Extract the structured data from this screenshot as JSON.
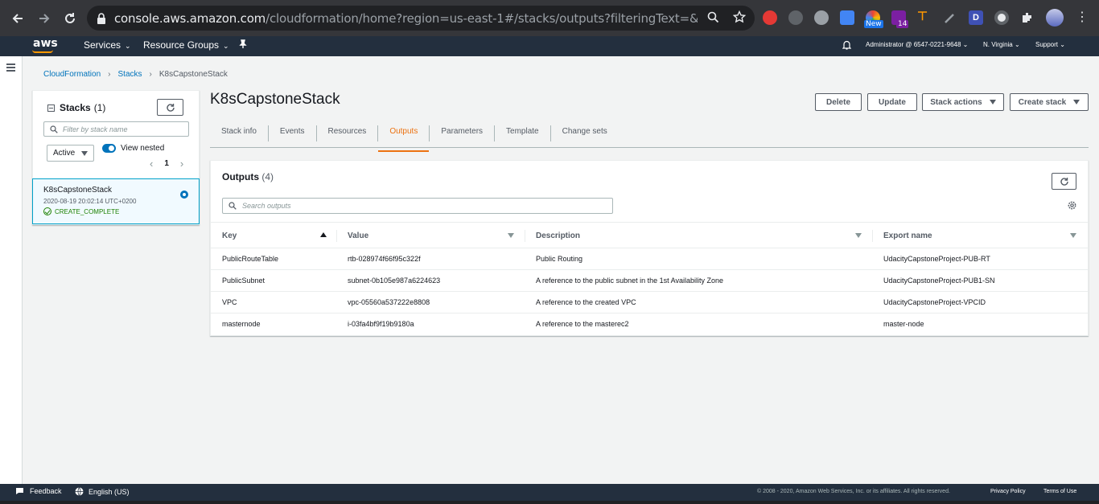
{
  "browser": {
    "url_host": "console.aws.amazon.com",
    "url_rest": "/cloudformation/home?region=us-east-1#/stacks/outputs?filteringText=&filteringStatus=...",
    "ext_badge_new": "New",
    "ext_badge_count": "14",
    "ext_letter": "D"
  },
  "awsnav": {
    "logo": "aws",
    "services": "Services",
    "resource_groups": "Resource Groups",
    "account": "Administrator @ 6547-0221-9648",
    "region": "N. Virginia",
    "support": "Support"
  },
  "breadcrumb": {
    "items": [
      "CloudFormation",
      "Stacks",
      "K8sCapstoneStack"
    ]
  },
  "stacks_panel": {
    "title": "Stacks",
    "count": "(1)",
    "filter_placeholder": "Filter by stack name",
    "status_filter": "Active",
    "view_nested": "View nested",
    "page": "1",
    "stack": {
      "name": "K8sCapstoneStack",
      "date": "2020-08-19 20:02:14 UTC+0200",
      "status": "CREATE_COMPLETE"
    }
  },
  "main": {
    "title": "K8sCapstoneStack",
    "buttons": {
      "delete": "Delete",
      "update": "Update",
      "stack_actions": "Stack actions",
      "create_stack": "Create stack"
    },
    "tabs": [
      "Stack info",
      "Events",
      "Resources",
      "Outputs",
      "Parameters",
      "Template",
      "Change sets"
    ],
    "active_tab": "Outputs"
  },
  "outputs": {
    "title": "Outputs",
    "count": "(4)",
    "search_placeholder": "Search outputs",
    "columns": [
      "Key",
      "Value",
      "Description",
      "Export name"
    ],
    "rows": [
      [
        "PublicRouteTable",
        "rtb-028974f66f95c322f",
        "Public Routing",
        "UdacityCapstoneProject-PUB-RT"
      ],
      [
        "PublicSubnet",
        "subnet-0b105e987a6224623",
        "A reference to the public subnet in the 1st Availability Zone",
        "UdacityCapstoneProject-PUB1-SN"
      ],
      [
        "VPC",
        "vpc-05560a537222e8808",
        "A reference to the created VPC",
        "UdacityCapstoneProject-VPCID"
      ],
      [
        "masternode",
        "i-03fa4bf9f19b9180a",
        "A reference to the masterec2",
        "master-node"
      ]
    ]
  },
  "footer": {
    "feedback": "Feedback",
    "language": "English (US)",
    "copyright": "© 2008 - 2020, Amazon Web Services, Inc. or its affiliates. All rights reserved.",
    "privacy": "Privacy Policy",
    "terms": "Terms of Use"
  },
  "colors": {
    "accent": "#ec7211",
    "link": "#0073bb",
    "success": "#1d8102",
    "header_bg": "#232f3e"
  }
}
